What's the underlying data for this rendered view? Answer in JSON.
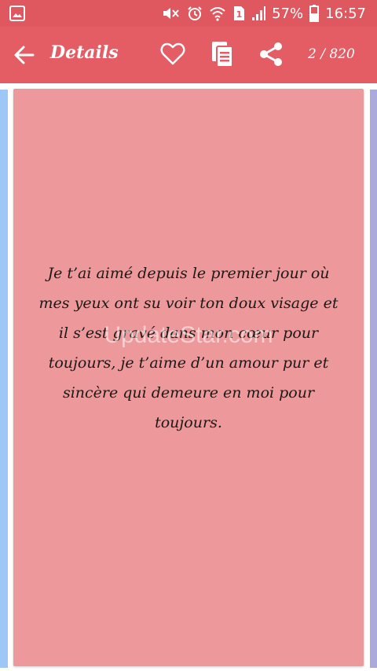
{
  "status_bar": {
    "battery": "57%",
    "time": "16:57",
    "sim": "1",
    "icons": [
      "image-icon",
      "mute-icon",
      "alarm-icon",
      "wifi-icon",
      "sim-icon",
      "signal-icon",
      "battery-icon"
    ]
  },
  "app_bar": {
    "title": "Details",
    "counter": "2 / 820",
    "icons": [
      "back-arrow-icon",
      "heart-icon",
      "copy-icon",
      "share-icon"
    ]
  },
  "card": {
    "quote": "Je t’ai aimé depuis le premier jour où mes yeux ont su voir ton doux visage et il s’est gravé dans mon cœur pour toujours, je t’aime d’un amour pur et sincère qui demeure en moi pour toujours.",
    "watermark": "UpdateStar.com",
    "color": "#ed989a"
  },
  "colors": {
    "status_bar": "#e0585f",
    "app_bar": "#e45d64",
    "peek_left": "#9cc7f6",
    "peek_right": "#aaaadc"
  }
}
